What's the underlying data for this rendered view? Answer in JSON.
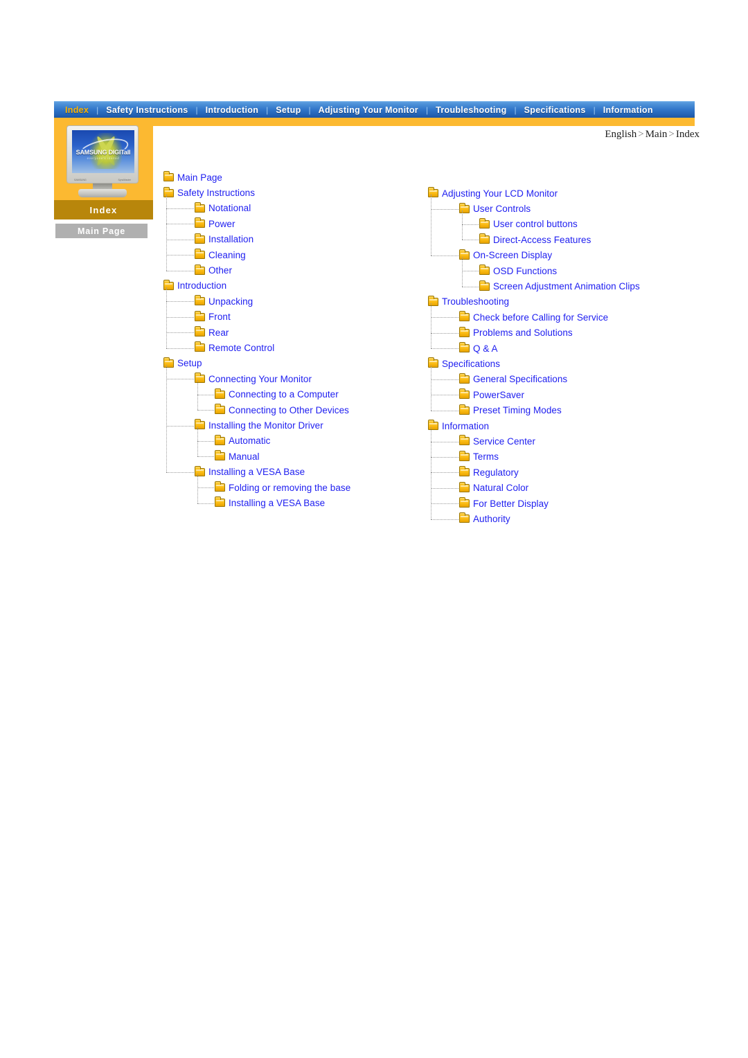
{
  "nav": {
    "items": [
      {
        "label": "Index",
        "active": true
      },
      {
        "label": "Safety Instructions",
        "active": false
      },
      {
        "label": "Introduction",
        "active": false
      },
      {
        "label": "Setup",
        "active": false
      },
      {
        "label": "Adjusting Your Monitor",
        "active": false
      },
      {
        "label": "Troubleshooting",
        "active": false
      },
      {
        "label": "Specifications",
        "active": false
      },
      {
        "label": "Information",
        "active": false
      }
    ],
    "separator": "|"
  },
  "sidebar": {
    "index_label": "Index",
    "main_page_button": "Main Page",
    "monitor": {
      "logo": "SAMSUNG DIGITall",
      "tagline": "everyone's invited",
      "label_left": "SAMSUNG",
      "label_right": "SyncMaster"
    }
  },
  "breadcrumb": {
    "part1": "English",
    "sep1": ">",
    "part2": "Main",
    "sep2": ">",
    "part3": "Index"
  },
  "colors": {
    "nav_gradient_top": "#5f9fe0",
    "nav_gradient_bottom": "#1d56a4",
    "nav_active_text": "#ffb400",
    "orange_band": "#fcb931",
    "index_bar": "#b8860b",
    "main_page_button": "#b0b0b0",
    "link_text": "#1d1df0",
    "folder_icon": "#fcbe18",
    "connector_line": "#9a9a9a"
  },
  "tree_left": [
    {
      "level": 1,
      "label": "Main Page"
    },
    {
      "level": 1,
      "label": "Safety Instructions"
    },
    {
      "level": 2,
      "label": "Notational"
    },
    {
      "level": 2,
      "label": "Power"
    },
    {
      "level": 2,
      "label": "Installation"
    },
    {
      "level": 2,
      "label": "Cleaning"
    },
    {
      "level": 2,
      "label": "Other"
    },
    {
      "level": 1,
      "label": "Introduction"
    },
    {
      "level": 2,
      "label": "Unpacking"
    },
    {
      "level": 2,
      "label": "Front"
    },
    {
      "level": 2,
      "label": "Rear"
    },
    {
      "level": 2,
      "label": "Remote Control"
    },
    {
      "level": 1,
      "label": "Setup"
    },
    {
      "level": 2,
      "label": "Connecting Your Monitor"
    },
    {
      "level": 3,
      "label": "Connecting to a Computer"
    },
    {
      "level": 3,
      "label": "Connecting to Other Devices"
    },
    {
      "level": 2,
      "label": "Installing the Monitor Driver"
    },
    {
      "level": 3,
      "label": "Automatic"
    },
    {
      "level": 3,
      "label": "Manual"
    },
    {
      "level": 2,
      "label": "Installing a VESA Base"
    },
    {
      "level": 3,
      "label": "Folding or removing the base"
    },
    {
      "level": 3,
      "label": "Installing a VESA Base"
    }
  ],
  "tree_right": [
    {
      "level": 1,
      "label": "Adjusting Your LCD Monitor"
    },
    {
      "level": 2,
      "label": "User Controls"
    },
    {
      "level": 3,
      "label": "User control buttons"
    },
    {
      "level": 3,
      "label": "Direct-Access Features"
    },
    {
      "level": 2,
      "label": "On-Screen Display"
    },
    {
      "level": 3,
      "label": "OSD Functions"
    },
    {
      "level": 3,
      "label": "Screen Adjustment Animation Clips"
    },
    {
      "level": 1,
      "label": "Troubleshooting"
    },
    {
      "level": 2,
      "label": "Check before Calling for Service"
    },
    {
      "level": 2,
      "label": "Problems and Solutions"
    },
    {
      "level": 2,
      "label": "Q & A"
    },
    {
      "level": 1,
      "label": "Specifications"
    },
    {
      "level": 2,
      "label": "General Specifications"
    },
    {
      "level": 2,
      "label": "PowerSaver"
    },
    {
      "level": 2,
      "label": "Preset Timing Modes"
    },
    {
      "level": 1,
      "label": "Information"
    },
    {
      "level": 2,
      "label": "Service Center"
    },
    {
      "level": 2,
      "label": "Terms"
    },
    {
      "level": 2,
      "label": "Regulatory"
    },
    {
      "level": 2,
      "label": "Natural Color"
    },
    {
      "level": 2,
      "label": "For Better Display"
    },
    {
      "level": 2,
      "label": "Authority"
    }
  ]
}
